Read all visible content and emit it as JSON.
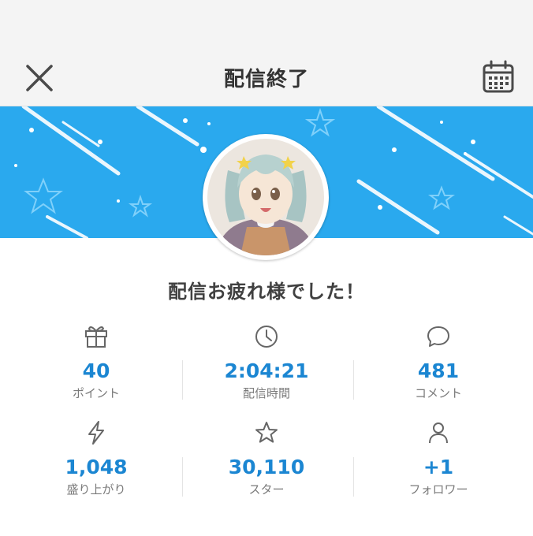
{
  "header": {
    "title": "配信終了",
    "close_icon": "close-icon",
    "calendar_icon": "calendar-icon"
  },
  "banner": {
    "color": "#2aa9ee",
    "decoration": "stars-and-streaks"
  },
  "profile": {
    "avatar_alt": "anime-girl-avatar"
  },
  "message": "配信お疲れ様でした！",
  "stats": [
    {
      "icon": "gift-icon",
      "value": "40",
      "label": "ポイント"
    },
    {
      "icon": "clock-icon",
      "value": "2:04:21",
      "label": "配信時間"
    },
    {
      "icon": "comment-bubble-icon",
      "value": "481",
      "label": "コメント"
    },
    {
      "icon": "lightning-icon",
      "value": "1,048",
      "label": "盛り上がり"
    },
    {
      "icon": "star-icon",
      "value": "30,110",
      "label": "スター"
    },
    {
      "icon": "person-icon",
      "value": "+1",
      "label": "フォロワー"
    }
  ],
  "colors": {
    "accent": "#1b86d2",
    "banner": "#2aa9ee",
    "label": "#7a7a7a",
    "icon": "#666666"
  }
}
